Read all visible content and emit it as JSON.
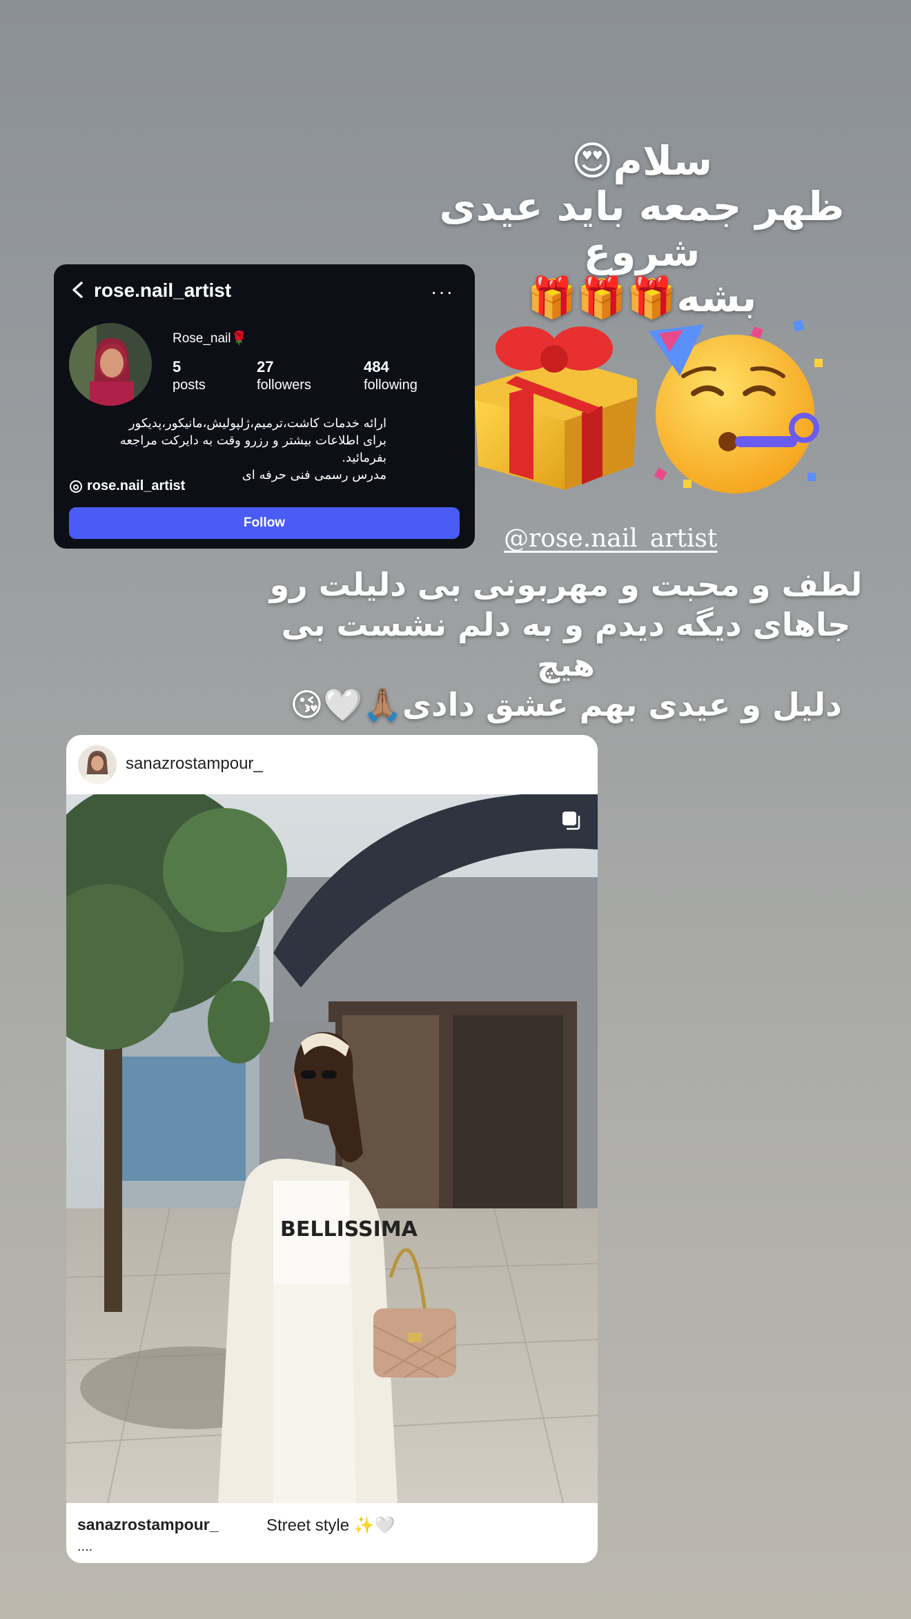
{
  "story": {
    "greeting_lines": [
      "سلام😍",
      "ظهر جمعه باید عیدی شروع",
      "بشه🎁🎁🎁"
    ],
    "mention": "@rose.nail_artist",
    "message_lines": [
      "لطف و محبت و مهربونی بی دلیلت رو",
      "جاهای دیگه دیدم و به دلم نشست بی هیچ",
      "دلیل و عیدی بهم عشق دادی🙏🏽🤍😘"
    ],
    "stickers": [
      "gift-icon",
      "partying-face-icon"
    ]
  },
  "profile_card": {
    "username": "rose.nail_artist",
    "display_name": "Rose_nail🌹",
    "stats": {
      "posts_count": "5",
      "posts_label": "posts",
      "followers_count": "27",
      "followers_label": "followers",
      "following_count": "484",
      "following_label": "following"
    },
    "bio_lines": [
      "ارائه خدمات کاشت،ترمیم،ژلپولیش،مانیکور،پدیکور",
      "برای اطلاعات بیشتر و رزرو وقت به دایرکت مراجعه بفرمائید.",
      "مدرس رسمی فنی حرفه ای"
    ],
    "threads_handle": "rose.nail_artist",
    "follow_label": "Follow",
    "more_label": "···"
  },
  "post_card": {
    "author": "sanazrostampour_",
    "caption_user": "sanazrostampour_",
    "caption_text": "Street style ✨🤍",
    "caption_more": "....",
    "colors": {
      "follow_button": "#4a5cf5",
      "card_dark": "#0c0f15"
    }
  }
}
